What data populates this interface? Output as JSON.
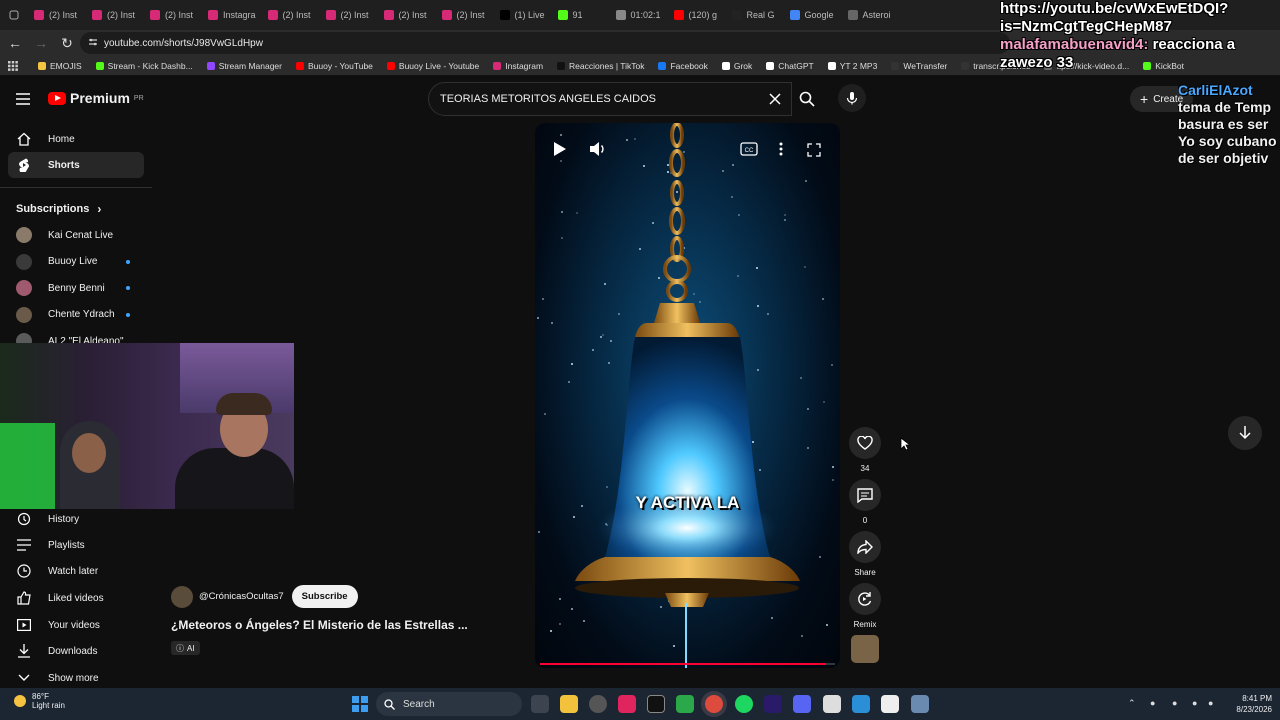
{
  "browser": {
    "tabs": [
      {
        "label": "(2) Inst",
        "color": "#d62976"
      },
      {
        "label": "(2) Inst",
        "color": "#d62976"
      },
      {
        "label": "(2) Inst",
        "color": "#d62976"
      },
      {
        "label": "Instagra",
        "color": "#d62976"
      },
      {
        "label": "(2) Inst",
        "color": "#d62976"
      },
      {
        "label": "(2) Inst",
        "color": "#d62976"
      },
      {
        "label": "(2) Inst",
        "color": "#d62976"
      },
      {
        "label": "(2) Inst",
        "color": "#d62976"
      },
      {
        "label": "(1) Live",
        "color": "#000000"
      },
      {
        "label": "91",
        "color": "#53fc18"
      },
      {
        "label": "01:02:1",
        "color": "#888888"
      },
      {
        "label": "(120) g",
        "color": "#ff0000"
      },
      {
        "label": "Real G",
        "color": "#222222"
      },
      {
        "label": "Google",
        "color": "#4285f4"
      },
      {
        "label": "Asteroi",
        "color": "#666666"
      }
    ],
    "url": "youtube.com/shorts/J98VwGLdHpw",
    "bookmarks": [
      "EMOJIS",
      "Stream - Kick Dashb...",
      "Stream Manager",
      "Buuoy - YouTube",
      "Buuoy Live - Youtube",
      "Instagram",
      "Reacciones | TikTok",
      "Facebook",
      "Grok",
      "ChatGPT",
      "YT 2 MP3",
      "WeTransfer",
      "transcripciones",
      "ttps://kick-video.d...",
      "KickBot"
    ]
  },
  "youtube": {
    "logo_text": "Premium",
    "logo_sup": "PR",
    "search_value": "TEORIAS METORITOS ANGELES CAIDOS",
    "create_label": "Create",
    "sidebar": {
      "home": "Home",
      "shorts": "Shorts",
      "subscriptions_header": "Subscriptions",
      "subscriptions": [
        {
          "name": "Kai Cenat Live",
          "color": "#8a7a6a"
        },
        {
          "name": "Buuoy Live",
          "color": "#3a3a3a"
        },
        {
          "name": "Benny Benni",
          "color": "#a05a70"
        },
        {
          "name": "Chente Ydrach",
          "color": "#6a5a4a"
        },
        {
          "name": "AL2 \"El Aldeano\"",
          "color": "#5a5a5a"
        }
      ],
      "history": "History",
      "playlists": "Playlists",
      "watch_later": "Watch later",
      "liked_videos": "Liked videos",
      "your_videos": "Your videos",
      "downloads": "Downloads",
      "show_more": "Show more"
    },
    "short": {
      "caption": "Y ACTIVA LA",
      "progress": 0.97,
      "likes": "34",
      "comments": "0",
      "share_label": "Share",
      "remix_label": "Remix",
      "channel": "@CrónicasOcultas7",
      "subscribe_label": "Subscribe",
      "title": "¿Meteoros o Ángeles? El Misterio de las Estrellas ...",
      "ai_badge": "AI"
    }
  },
  "chat_overlay": {
    "line1": "https://youtu.be/cvWxEwEtDQI?",
    "line2": "is=NzmCgtTegCHepM87",
    "user": "malafamabuenavid4:",
    "msg_part1": "reacciona a",
    "msg_part2": "zawezo 33",
    "side_user": "CarliElAzot",
    "side_lines": [
      "tema de Temp",
      "basura es ser",
      "Yo soy cubano",
      "de ser objetiv"
    ]
  },
  "taskbar": {
    "temperature": "86°F",
    "condition": "Light rain",
    "search_label": "Search",
    "time": "8:41 PM",
    "date": "8/23/2026"
  }
}
